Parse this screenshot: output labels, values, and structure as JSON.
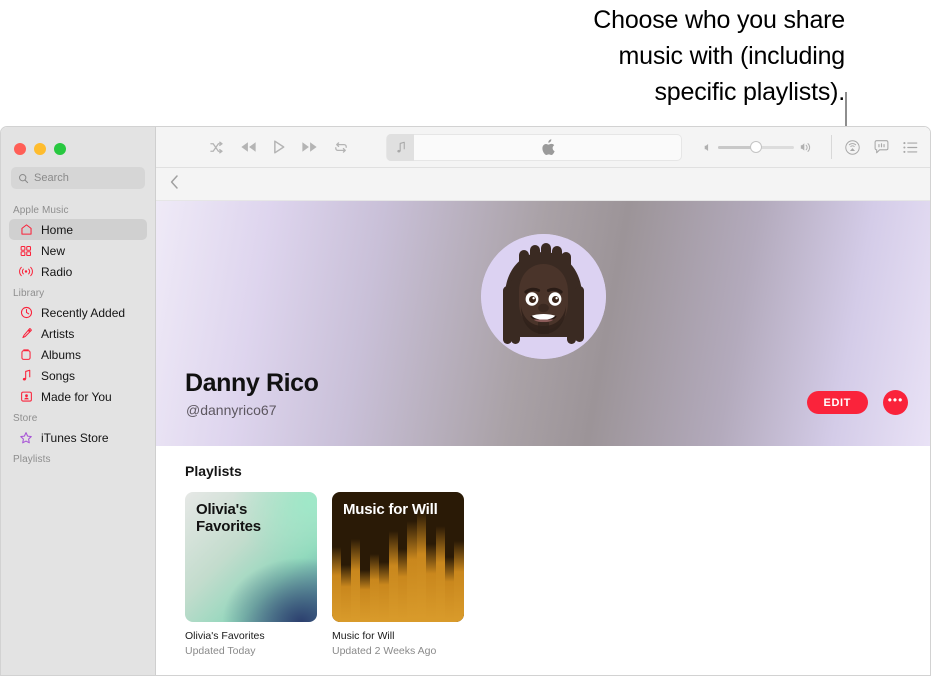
{
  "callout": {
    "line1": "Choose who you share",
    "line2": "music with (including",
    "line3": "specific playlists)."
  },
  "window": {
    "traffic": {
      "close": "close",
      "minimize": "minimize",
      "zoom": "zoom"
    }
  },
  "sidebar": {
    "search": {
      "placeholder": "Search"
    },
    "sections": [
      {
        "title": "Apple Music",
        "items": [
          {
            "label": "Home",
            "icon": "home-icon",
            "active": true
          },
          {
            "label": "New",
            "icon": "new-icon",
            "active": false
          },
          {
            "label": "Radio",
            "icon": "radio-icon",
            "active": false
          }
        ]
      },
      {
        "title": "Library",
        "items": [
          {
            "label": "Recently Added",
            "icon": "clock-icon",
            "active": false
          },
          {
            "label": "Artists",
            "icon": "microphone-icon",
            "active": false
          },
          {
            "label": "Albums",
            "icon": "album-icon",
            "active": false
          },
          {
            "label": "Songs",
            "icon": "music-note-icon",
            "active": false
          },
          {
            "label": "Made for You",
            "icon": "made-for-you-icon",
            "active": false
          }
        ]
      },
      {
        "title": "Store",
        "items": [
          {
            "label": "iTunes Store",
            "icon": "star-icon",
            "active": false
          }
        ]
      },
      {
        "title": "Playlists",
        "items": []
      }
    ]
  },
  "toolbar": {
    "shuffle": "shuffle-icon",
    "previous": "rewind-icon",
    "play": "play-icon",
    "next": "fast-forward-icon",
    "repeat": "repeat-icon",
    "now_playing": {
      "thumb_icon": "music-note-icon",
      "center_icon": "apple-logo-icon"
    },
    "volume": {
      "min_icon": "volume-low-icon",
      "max_icon": "volume-high-icon",
      "level": 50
    },
    "airplay": "airplay-icon",
    "lyrics": "lyrics-icon",
    "queue": "queue-list-icon",
    "back": "chevron-left-icon"
  },
  "profile": {
    "name": "Danny Rico",
    "handle": "@dannyrico67",
    "avatar": "memoji-avatar",
    "edit_label": "EDIT",
    "more_label": "•••",
    "accent_color": "#fa233b"
  },
  "playlists": {
    "heading": "Playlists",
    "items": [
      {
        "art_title": "Olivia's\nFavorites",
        "title": "Olivia's Favorites",
        "subtitle": "Updated Today"
      },
      {
        "art_title": "Music for Will",
        "title": "Music for Will",
        "subtitle": "Updated 2 Weeks Ago"
      }
    ]
  }
}
